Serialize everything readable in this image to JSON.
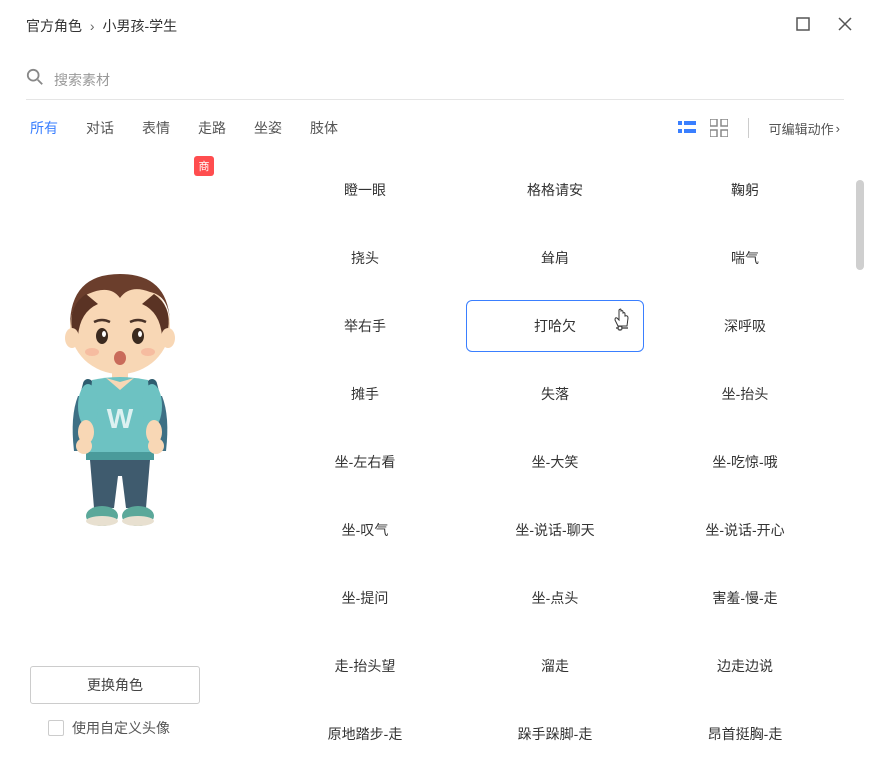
{
  "breadcrumb": {
    "root": "官方角色",
    "current": "小男孩-学生"
  },
  "search": {
    "placeholder": "搜索素材"
  },
  "tabs": [
    "所有",
    "对话",
    "表情",
    "走路",
    "坐姿",
    "肢体"
  ],
  "active_tab": "所有",
  "editable_label": "可编辑动作",
  "badge_text": "商",
  "actions": [
    [
      "瞪一眼",
      "格格请安",
      "鞠躬"
    ],
    [
      "挠头",
      "耸肩",
      "喘气"
    ],
    [
      "举右手",
      "打哈欠",
      "深呼吸"
    ],
    [
      "摊手",
      "失落",
      "坐-抬头"
    ],
    [
      "坐-左右看",
      "坐-大笑",
      "坐-吃惊-哦"
    ],
    [
      "坐-叹气",
      "坐-说话-聊天",
      "坐-说话-开心"
    ],
    [
      "坐-提问",
      "坐-点头",
      "害羞-慢-走"
    ],
    [
      "走-抬头望",
      "溜走",
      "边走边说"
    ],
    [
      "原地踏步-走",
      "跺手跺脚-走",
      "昂首挺胸-走"
    ]
  ],
  "selected_action": "打哈欠",
  "change_char_label": "更换角色",
  "custom_avatar_label": "使用自定义头像"
}
